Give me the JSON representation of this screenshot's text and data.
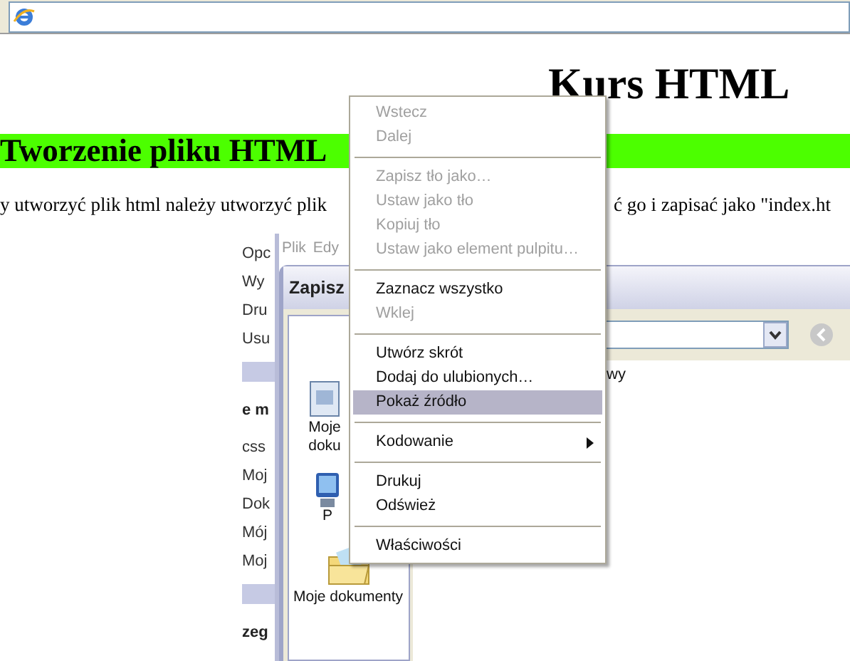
{
  "page": {
    "title": "Kurs HTML",
    "section_heading": "Tworzenie pliku HTML",
    "paragraph_left": "y utworzyć plik html należy utworzyć plik",
    "paragraph_right": "ć go i zapisać jako \"index.ht"
  },
  "embedded_screenshot": {
    "side_panel": [
      {
        "kind": "item",
        "text": "Opc"
      },
      {
        "kind": "item",
        "text": "Wy"
      },
      {
        "kind": "item",
        "text": "Dru"
      },
      {
        "kind": "item",
        "text": "Usu"
      },
      {
        "kind": "band"
      },
      {
        "kind": "header",
        "text": "e m"
      },
      {
        "kind": "item",
        "text": "css"
      },
      {
        "kind": "item",
        "text": "Moj"
      },
      {
        "kind": "item",
        "text": "Dok"
      },
      {
        "kind": "item",
        "text": "Mój"
      },
      {
        "kind": "item",
        "text": "Moj"
      },
      {
        "kind": "band"
      },
      {
        "kind": "header",
        "text": "zeg"
      }
    ],
    "menu_bar": [
      "Plik",
      "Edy"
    ],
    "dialog": {
      "title": "Zapisz",
      "places": [
        {
          "lines": [
            "Moje",
            "doku"
          ],
          "kind": "documents"
        },
        {
          "lines": [
            "P"
          ],
          "kind": "computer"
        },
        {
          "lines": [
            "Moje dokumenty"
          ],
          "kind": "folder"
        }
      ],
      "file_list": [
        "wy"
      ]
    }
  },
  "context_menu": [
    {
      "kind": "item",
      "label": "Wstecz",
      "disabled": true,
      "selected": false
    },
    {
      "kind": "item",
      "label": "Dalej",
      "disabled": true,
      "selected": false
    },
    {
      "kind": "separator"
    },
    {
      "kind": "item",
      "label": "Zapisz tło jako…",
      "disabled": true,
      "selected": false
    },
    {
      "kind": "item",
      "label": "Ustaw jako tło",
      "disabled": true,
      "selected": false
    },
    {
      "kind": "item",
      "label": "Kopiuj tło",
      "disabled": true,
      "selected": false
    },
    {
      "kind": "item",
      "label": "Ustaw jako element pulpitu…",
      "disabled": true,
      "selected": false
    },
    {
      "kind": "separator"
    },
    {
      "kind": "item",
      "label": "Zaznacz wszystko",
      "disabled": false,
      "selected": false
    },
    {
      "kind": "item",
      "label": "Wklej",
      "disabled": true,
      "selected": false
    },
    {
      "kind": "separator"
    },
    {
      "kind": "item",
      "label": "Utwórz skrót",
      "disabled": false,
      "selected": false
    },
    {
      "kind": "item",
      "label": "Dodaj do ulubionych…",
      "disabled": false,
      "selected": false
    },
    {
      "kind": "item",
      "label": "Pokaż źródło",
      "disabled": false,
      "selected": true
    },
    {
      "kind": "separator"
    },
    {
      "kind": "item",
      "label": "Kodowanie",
      "disabled": false,
      "selected": false,
      "submenu": true
    },
    {
      "kind": "separator"
    },
    {
      "kind": "item",
      "label": "Drukuj",
      "disabled": false,
      "selected": false
    },
    {
      "kind": "item",
      "label": "Odśwież",
      "disabled": false,
      "selected": false
    },
    {
      "kind": "separator"
    },
    {
      "kind": "item",
      "label": "Właściwości",
      "disabled": false,
      "selected": false
    }
  ]
}
